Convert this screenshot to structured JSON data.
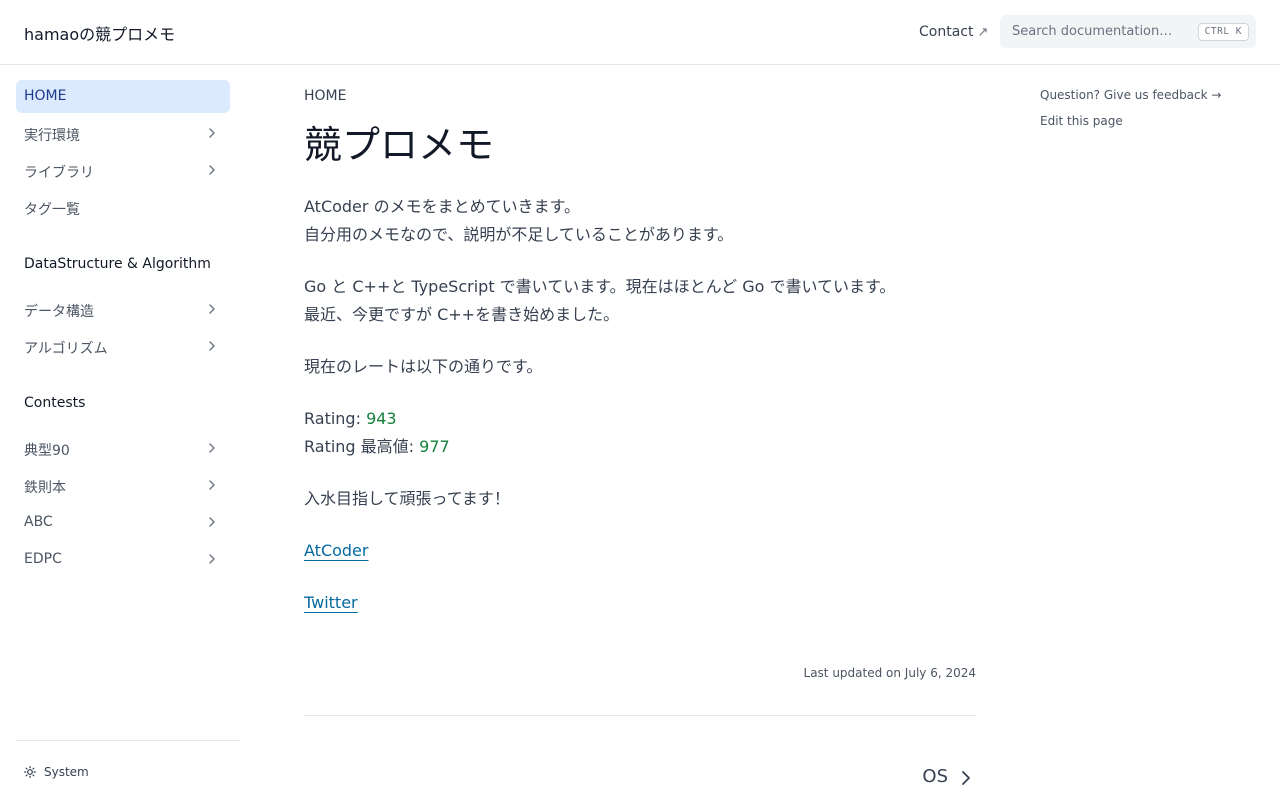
{
  "navbar": {
    "site_title": "hamaoの競プロメモ",
    "contact_label": "Contact",
    "contact_icon": "external-arrow-icon",
    "search": {
      "placeholder": "Search documentation…",
      "shortcut": "CTRL K"
    }
  },
  "sidebar": {
    "items": [
      {
        "label": "HOME",
        "active": true,
        "expandable": false
      },
      {
        "label": "実行環境",
        "expandable": true
      },
      {
        "label": "ライブラリ",
        "expandable": true
      },
      {
        "label": "タグ一覧",
        "expandable": false
      }
    ],
    "sections": [
      {
        "heading": "DataStructure & Algorithm",
        "items": [
          {
            "label": "データ構造",
            "expandable": true
          },
          {
            "label": "アルゴリズム",
            "expandable": true
          }
        ]
      },
      {
        "heading": "Contests",
        "items": [
          {
            "label": "典型90",
            "expandable": true
          },
          {
            "label": "鉄則本",
            "expandable": true
          },
          {
            "label": "ABC",
            "expandable": true
          },
          {
            "label": "EDPC",
            "expandable": true
          }
        ]
      }
    ],
    "theme_label": "System"
  },
  "main": {
    "breadcrumb": "HOME",
    "title": "競プロメモ",
    "p1_line1": "AtCoder のメモをまとめていきます。",
    "p1_line2": "自分用のメモなので、説明が不足していることがあります。",
    "p2_line1": "Go と C++と TypeScript で書いています。現在はほとんど Go で書いています。",
    "p2_line2": "最近、今更ですが C++を書き始めました。",
    "p3": "現在のレートは以下の通りです。",
    "rating_label": "Rating: ",
    "rating_value": "943",
    "max_rating_label": "Rating 最高値: ",
    "max_rating_value": "977",
    "p5": "入水目指して頑張ってます！",
    "link_atcoder": "AtCoder",
    "link_twitter": "Twitter",
    "last_updated": "Last updated on July 6, 2024",
    "next_label": "OS"
  },
  "toc": {
    "feedback": "Question? Give us feedback →",
    "edit": "Edit this page"
  },
  "colors": {
    "accent": "#0369a1",
    "active_bg": "#dbeafe",
    "rating_green": "#15803d"
  }
}
